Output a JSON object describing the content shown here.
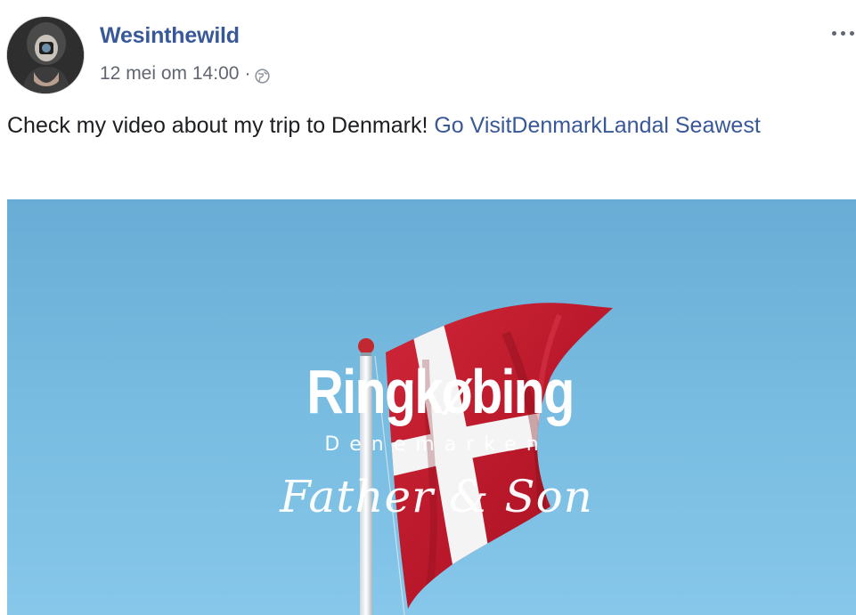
{
  "post": {
    "author": "Wesinthewild",
    "timestamp": "12 mei om 14:00",
    "separator": "·",
    "audience_icon": "globe-icon",
    "more_icon": "more-options-icon",
    "text": "Check my video about my trip to Denmark!",
    "tags": [
      "Go VisitDenmark",
      "Landal Seawest"
    ]
  },
  "video": {
    "title": "Ringkøbing",
    "subtitle": "Denemarken",
    "tagline": "Father & Son"
  },
  "colors": {
    "link": "#385898",
    "sky": "#79bde2",
    "flag_red": "#c8102e",
    "flag_white": "#ffffff"
  }
}
